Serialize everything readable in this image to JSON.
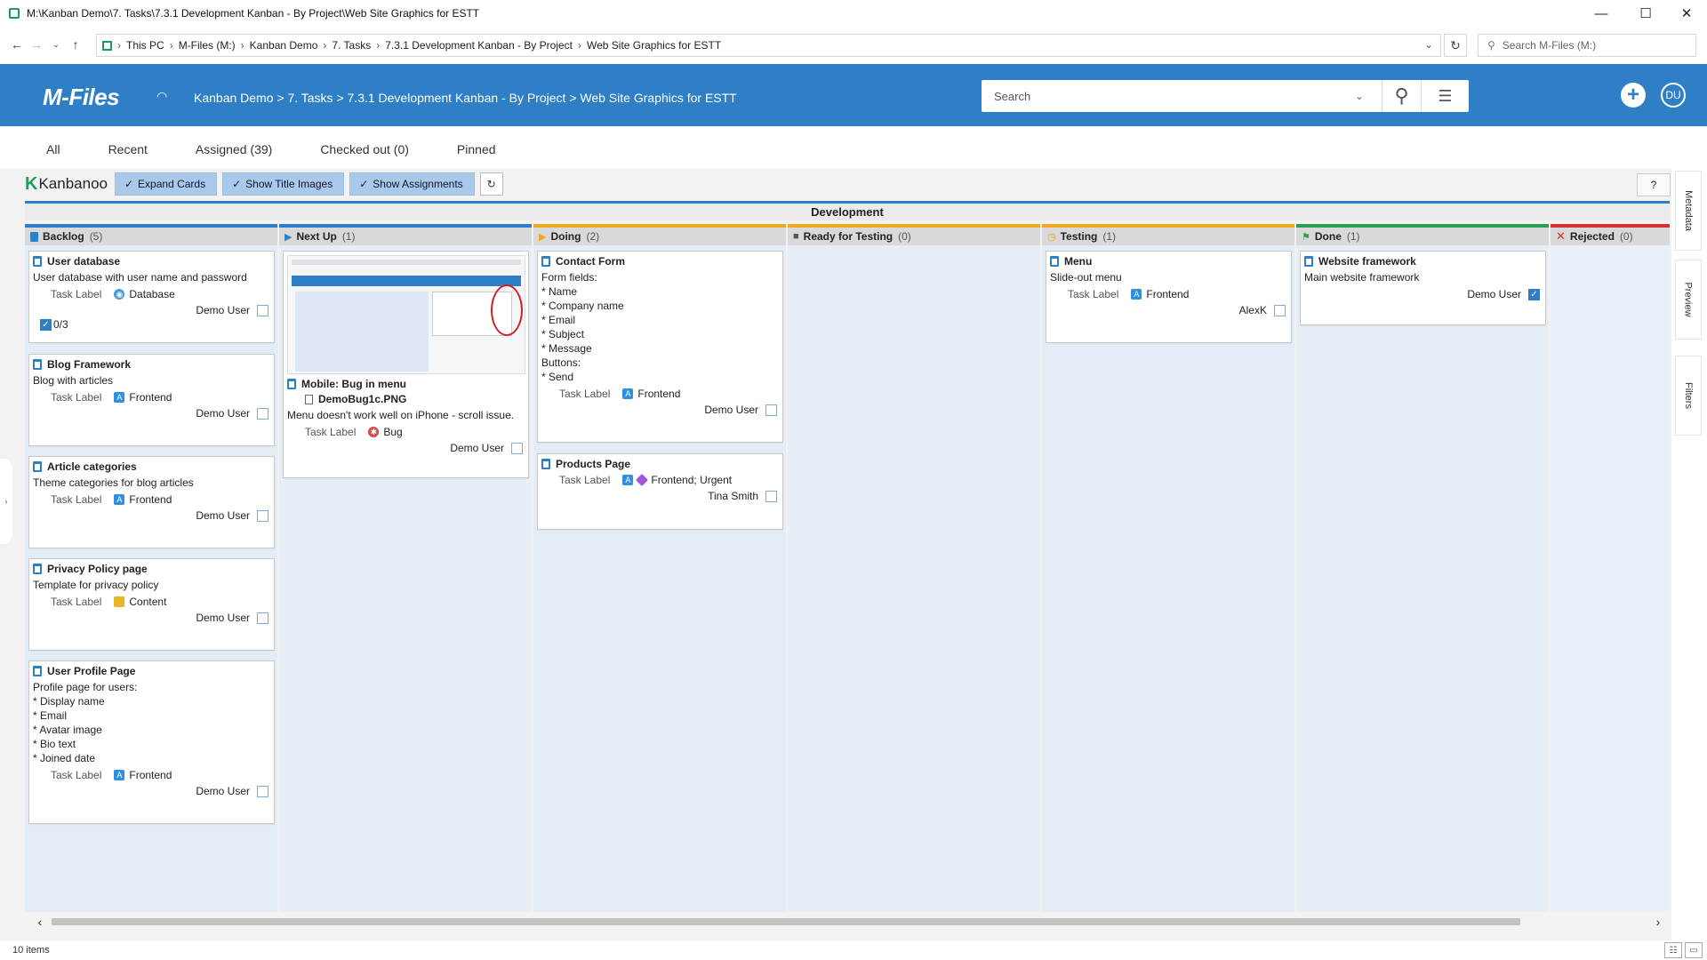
{
  "window": {
    "title": "M:\\Kanban Demo\\7. Tasks\\7.3.1 Development Kanban - By Project\\Web Site Graphics for ESTT",
    "minimize": "—",
    "maximize": "☐",
    "close": "✕"
  },
  "address": {
    "segments": [
      "This PC",
      "M-Files (M:)",
      "Kanban Demo",
      "7. Tasks",
      "7.3.1 Development Kanban - By Project",
      "Web Site Graphics for ESTT"
    ],
    "search_placeholder": "Search M-Files (M:)"
  },
  "mfiles": {
    "logo": "M-Files",
    "breadcrumb": "Kanban Demo > 7. Tasks > 7.3.1 Development Kanban - By Project > Web Site Graphics for ESTT",
    "search_placeholder": "Search",
    "avatar": "DU"
  },
  "view_tabs": [
    "All",
    "Recent",
    "Assigned (39)",
    "Checked out (0)",
    "Pinned"
  ],
  "toolbar": {
    "logo": "Kanbanoo",
    "expand_cards": "Expand Cards",
    "show_title_images": "Show Title Images",
    "show_assignments": "Show Assignments",
    "help": "?"
  },
  "swimlane": "Development",
  "columns": [
    {
      "name": "Backlog",
      "count": "(5)",
      "color": "#2f7fc6"
    },
    {
      "name": "Next Up",
      "count": "(1)",
      "color": "#2f7fc6"
    },
    {
      "name": "Doing",
      "count": "(2)",
      "color": "#f0a820"
    },
    {
      "name": "Ready for Testing",
      "count": "(0)",
      "color": "#f0a820"
    },
    {
      "name": "Testing",
      "count": "(1)",
      "color": "#f0a820"
    },
    {
      "name": "Done",
      "count": "(1)",
      "color": "#2aa050"
    },
    {
      "name": "Rejected",
      "count": "(0)",
      "color": "#d83030"
    }
  ],
  "cards": {
    "user_database": {
      "title": "User database",
      "desc": "User database with user name and password",
      "label_key": "Task Label",
      "label": "Database",
      "assignee": "Demo User",
      "checklist": "0/3"
    },
    "blog_framework": {
      "title": "Blog Framework",
      "desc": "Blog with articles",
      "label_key": "Task Label",
      "label": "Frontend",
      "assignee": "Demo User"
    },
    "article_categories": {
      "title": "Article categories",
      "desc": "Theme categories for blog articles",
      "label_key": "Task Label",
      "label": "Frontend",
      "assignee": "Demo User"
    },
    "privacy_policy": {
      "title": "Privacy Policy page",
      "desc": "Template for privacy policy",
      "label_key": "Task Label",
      "label": "Content",
      "assignee": "Demo User"
    },
    "user_profile": {
      "title": "User Profile Page",
      "desc": "Profile page for users:\n* Display name\n* Email\n* Avatar image\n* Bio text\n* Joined date",
      "label_key": "Task Label",
      "label": "Frontend",
      "assignee": "Demo User"
    },
    "mobile_bug": {
      "title": "Mobile: Bug in menu",
      "attachment": "DemoBug1c.PNG",
      "desc": "Menu doesn't work well on iPhone - scroll issue.",
      "label_key": "Task Label",
      "label": "Bug",
      "assignee": "Demo User"
    },
    "contact_form": {
      "title": "Contact Form",
      "desc": "Form fields:\n* Name\n* Company name\n* Email\n* Subject\n* Message\nButtons:\n* Send",
      "label_key": "Task Label",
      "label": "Frontend",
      "assignee": "Demo User"
    },
    "products_page": {
      "title": "Products Page",
      "label_key": "Task Label",
      "label": "Frontend; Urgent",
      "assignee": "Tina Smith"
    },
    "menu": {
      "title": "Menu",
      "desc": "Slide-out menu",
      "label_key": "Task Label",
      "label": "Frontend",
      "assignee": "AlexK"
    },
    "website_framework": {
      "title": "Website framework",
      "desc": "Main website framework",
      "assignee": "Demo User"
    }
  },
  "side_tabs": [
    "Metadata",
    "Preview",
    "Filters"
  ],
  "status": "10 items"
}
